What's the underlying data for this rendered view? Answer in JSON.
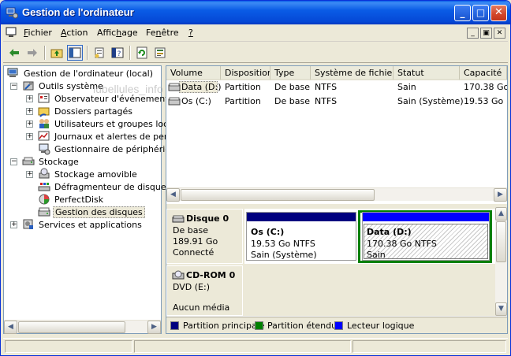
{
  "window": {
    "title": "Gestion de l'ordinateur",
    "controls": {
      "minimize": "_",
      "maximize": "□",
      "close": "✕"
    }
  },
  "menubar": {
    "items": [
      {
        "label": "Fichier"
      },
      {
        "label": "Action"
      },
      {
        "label": "Affichage"
      },
      {
        "label": "Fenêtre"
      },
      {
        "label": "?"
      }
    ]
  },
  "toolbar": {
    "icons": [
      "back-arrow-icon",
      "forward-arrow-icon",
      "up-folder-icon",
      "show-hide-tree-icon",
      "properties-icon",
      "help-icon",
      "refresh-icon",
      "export-list-icon"
    ]
  },
  "tree": {
    "items": [
      {
        "label": "Gestion de l'ordinateur (local)",
        "icon": "computer-icon"
      },
      {
        "label": "Outils système",
        "icon": "tools-icon"
      },
      {
        "label": "Observateur d'événements",
        "icon": "event-viewer-icon"
      },
      {
        "label": "Dossiers partagés",
        "icon": "shared-folder-icon"
      },
      {
        "label": "Utilisateurs et groupes locaux",
        "icon": "users-icon"
      },
      {
        "label": "Journaux et alertes de performance",
        "icon": "performance-icon"
      },
      {
        "label": "Gestionnaire de périphériques",
        "icon": "device-manager-icon"
      },
      {
        "label": "Stockage",
        "icon": "storage-icon"
      },
      {
        "label": "Stockage amovible",
        "icon": "removable-storage-icon"
      },
      {
        "label": "Défragmenteur de disque",
        "icon": "defragmenter-icon"
      },
      {
        "label": "PerfectDisk",
        "icon": "perfectdisk-icon"
      },
      {
        "label": "Gestion des disques",
        "icon": "disk-management-icon"
      },
      {
        "label": "Services et applications",
        "icon": "services-icon"
      }
    ]
  },
  "volumes": {
    "columns": [
      "Volume",
      "Disposition",
      "Type",
      "Système de fichiers",
      "Statut",
      "Capacité"
    ],
    "rows": [
      [
        "Data (D:)",
        "Partition",
        "De base",
        "NTFS",
        "Sain",
        "170.38 Go"
      ],
      [
        "Os (C:)",
        "Partition",
        "De base",
        "NTFS",
        "Sain (Système)",
        "19.53 Go"
      ]
    ]
  },
  "disks": {
    "disk0": {
      "name": "Disque 0",
      "type": "De base",
      "size": "189.91 Go",
      "state": "Connecté",
      "partitions": [
        {
          "title": "Os  (C:)",
          "size": "19.53 Go NTFS",
          "status": "Sain (Système)"
        },
        {
          "title": "Data  (D:)",
          "size": "170.38 Go NTFS",
          "status": "Sain"
        }
      ]
    },
    "cdrom0": {
      "name": "CD-ROM 0",
      "drive": "DVD (E:)",
      "media": "Aucun média"
    }
  },
  "legend": {
    "items": [
      {
        "label": "Partition principale",
        "color": "#00007f"
      },
      {
        "label": "Partition étendue",
        "color": "#008000"
      },
      {
        "label": "Lecteur logique",
        "color": "#0000ff"
      }
    ]
  },
  "watermark": "lubellules_info",
  "colors": {
    "title_bar": "#0a5ce6",
    "primary_partition": "#00007f",
    "extended_partition": "#008000",
    "logical_drive": "#0000ff",
    "close_button": "#d2452a"
  }
}
